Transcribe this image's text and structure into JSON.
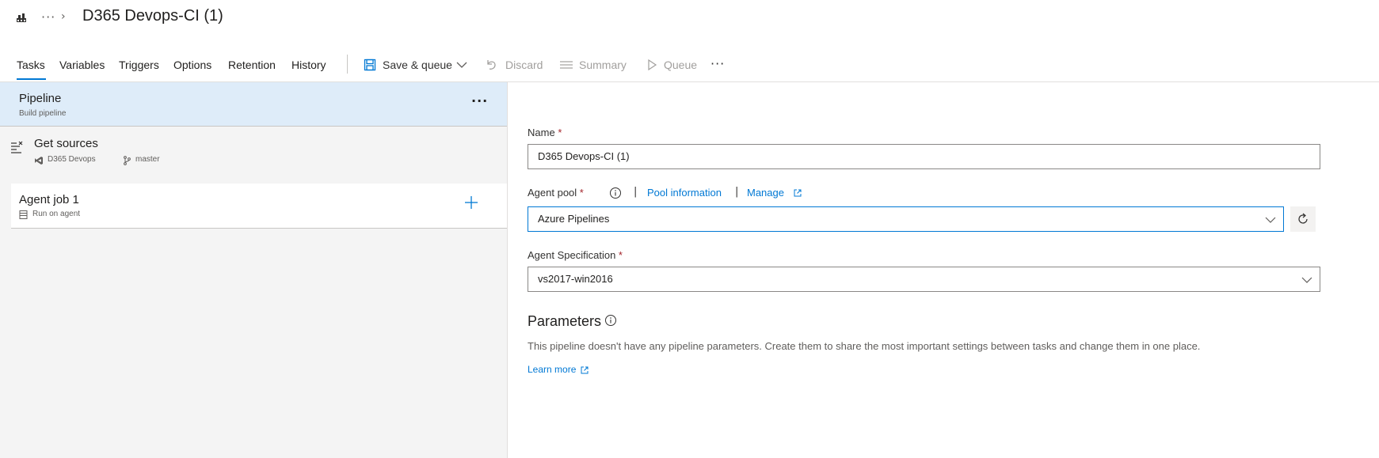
{
  "header": {
    "title": "D365 Devops-CI (1)",
    "breadcrumb_more": "···",
    "breadcrumb_sep": "›"
  },
  "tabs": [
    {
      "label": "Tasks",
      "active": true
    },
    {
      "label": "Variables"
    },
    {
      "label": "Triggers"
    },
    {
      "label": "Options"
    },
    {
      "label": "Retention"
    },
    {
      "label": "History"
    }
  ],
  "toolbar": {
    "save_queue": "Save & queue",
    "discard": "Discard",
    "summary": "Summary",
    "queue": "Queue",
    "more": "···"
  },
  "left": {
    "pipeline": {
      "title": "Pipeline",
      "subtitle": "Build pipeline",
      "more": "···"
    },
    "sources": {
      "title": "Get sources",
      "repo": "D365 Devops",
      "branch": "master"
    },
    "job": {
      "title": "Agent job 1",
      "subtitle": "Run on agent"
    }
  },
  "form": {
    "name_label": "Name",
    "required_mark": "*",
    "name_value": "D365 Devops-CI (1)",
    "agent_pool_label": "Agent pool",
    "pool_info_link": "Pool information",
    "manage_link": "Manage",
    "link_separator": "|",
    "agent_pool_value": "Azure Pipelines",
    "agent_spec_label": "Agent Specification",
    "agent_spec_value": "vs2017-win2016"
  },
  "parameters": {
    "title": "Parameters",
    "description": "This pipeline doesn't have any pipeline parameters. Create them to share the most important settings between tasks and change them in one place.",
    "learn_more": "Learn more"
  },
  "colors": {
    "accent": "#0078d4",
    "selected_row": "#deecf9",
    "panel_bg": "#f4f4f4",
    "required": "#a4262c"
  }
}
